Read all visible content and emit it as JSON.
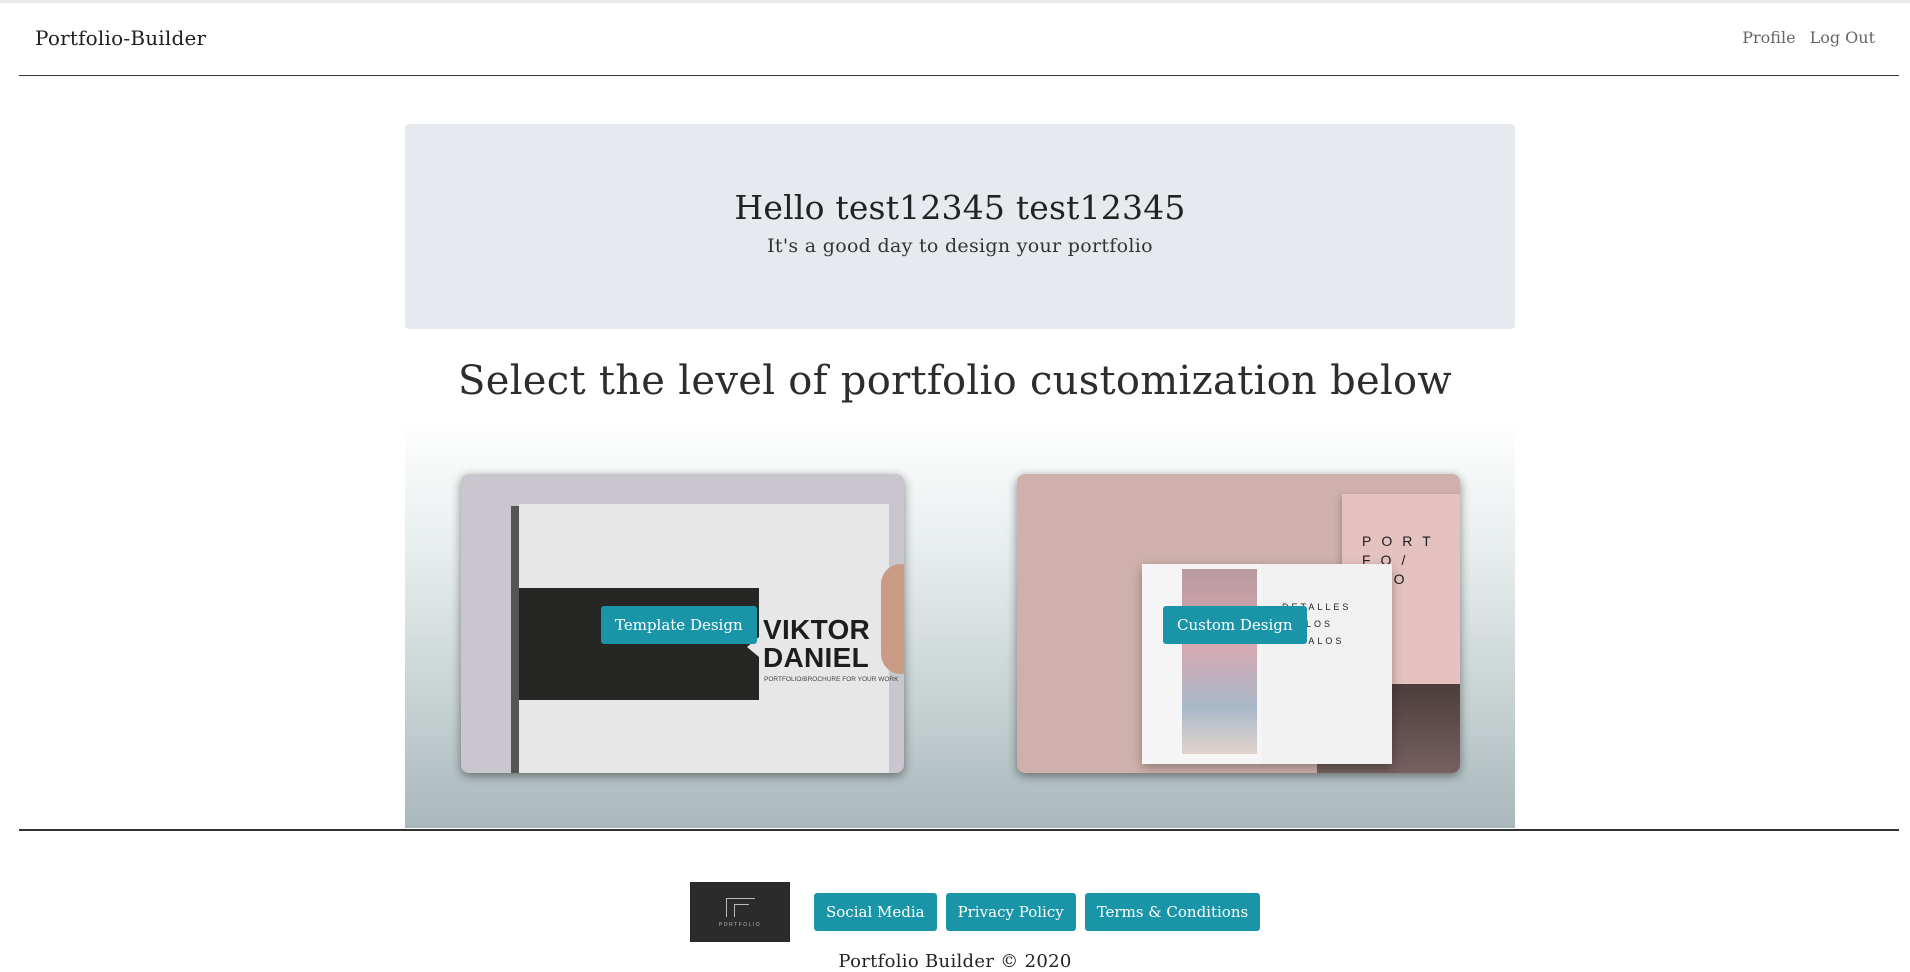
{
  "navbar": {
    "brand": "Portfolio-Builder",
    "links": [
      "Profile",
      "Log Out"
    ]
  },
  "hero": {
    "greeting": "Hello test12345 test12345",
    "subtitle": "It's a good day to design your portfolio"
  },
  "selection": {
    "heading": "Select the level of portfolio customization below",
    "cards": [
      {
        "button_label": "Template Design",
        "image_text": {
          "title": "VIKTOR\nDANIEL",
          "tagline": "PORTFOLIO/BROCHURE FOR YOUR WORK"
        }
      },
      {
        "button_label": "Custom Design",
        "image_text": {
          "poster": "PORT\nFO/\nLIO",
          "page": "DETALLES\nEN LOS\nDETALOS"
        }
      }
    ]
  },
  "footer": {
    "logo_word": "PORTFOLIO",
    "links": [
      "Social Media",
      "Privacy Policy",
      "Terms & Conditions"
    ],
    "copyright": "Portfolio Builder © 2020"
  },
  "colors": {
    "accent": "#1a95a8",
    "hero_background": "#e6e9ed",
    "rule": "#333333"
  }
}
